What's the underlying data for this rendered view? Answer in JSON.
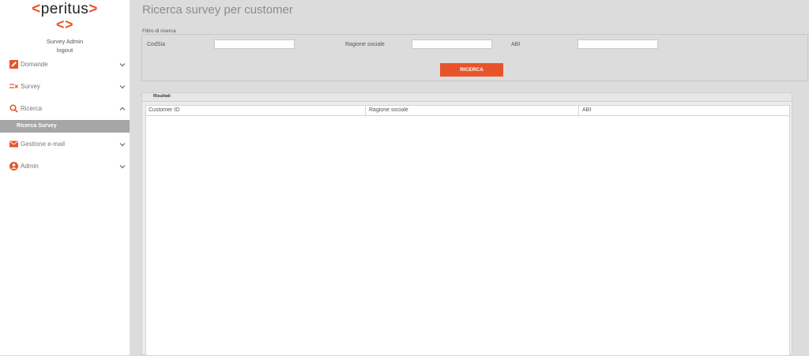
{
  "app": {
    "logo_left": "<",
    "logo_word": "peritus",
    "logo_right": ">",
    "logo_mark": "<>",
    "user": "Survey Admin",
    "logout": "logout"
  },
  "sidebar": {
    "items": [
      {
        "label": "Domande",
        "icon": "pencil-icon"
      },
      {
        "label": "Survey",
        "icon": "checklist-icon"
      },
      {
        "label": "Ricerca",
        "icon": "search-icon",
        "expanded": true,
        "sub": [
          {
            "label": "Ricerca Survey",
            "active": true
          }
        ]
      },
      {
        "label": "Gestione e-mail",
        "icon": "envelope-icon"
      },
      {
        "label": "Admin",
        "icon": "user-circle-icon"
      }
    ]
  },
  "page": {
    "title": "Ricerca survey per customer"
  },
  "filter": {
    "legend": "Filtro di ricerca",
    "codsia_label": "CodSia",
    "ragione_label": "Ragione sociale",
    "abi_label": "ABI",
    "codsia_value": "",
    "ragione_value": "",
    "abi_value": "",
    "search_button": "RICERCA"
  },
  "results": {
    "tab_label": "Risultati",
    "columns": [
      "Customer ID",
      "Ragione sociale",
      "ABI"
    ],
    "rows": []
  },
  "colors": {
    "accent": "#e8542a",
    "background": "#dcdcdc",
    "sidebar": "#ffffff"
  }
}
